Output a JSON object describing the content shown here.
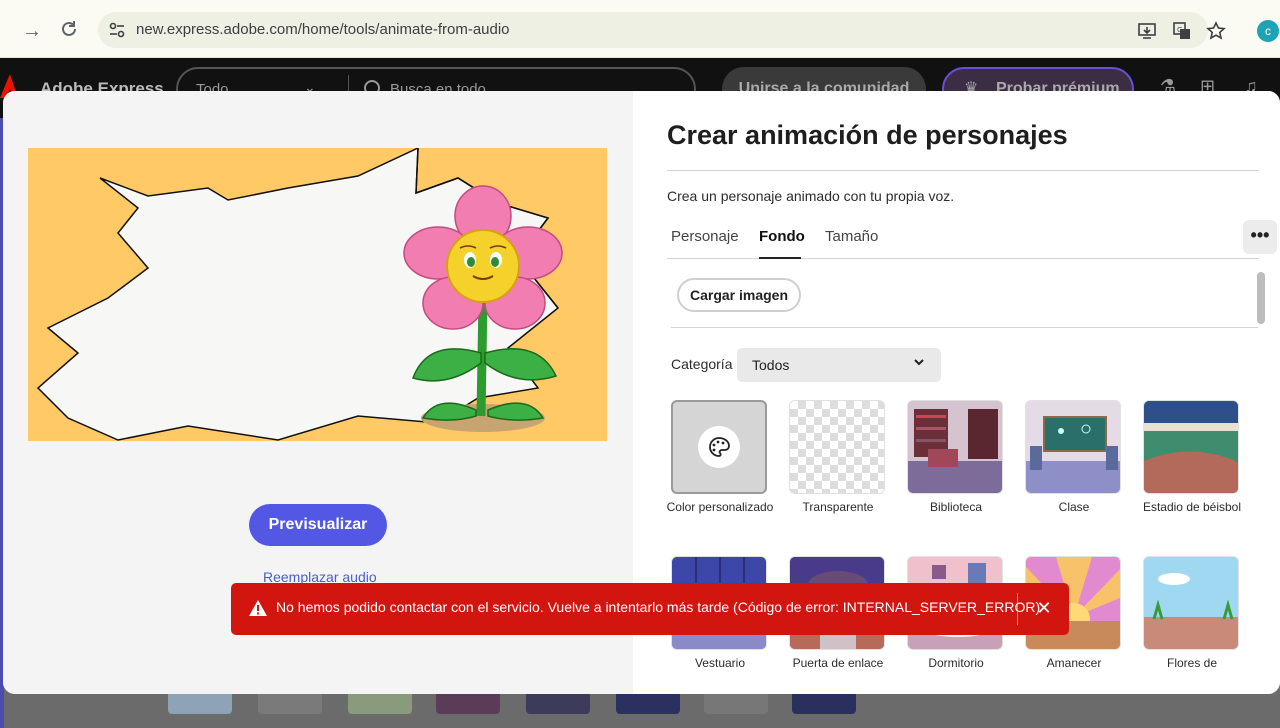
{
  "browser": {
    "url": "new.express.adobe.com/home/tools/animate-from-audio",
    "profile_initial": "c",
    "icons": [
      "back-arrow-icon",
      "reload-icon",
      "site-settings-icon",
      "install-icon",
      "translate-icon",
      "bookmark-star-icon"
    ]
  },
  "app_header": {
    "name": "Adobe Express",
    "filter_select": "Todo",
    "search_placeholder": "Busca en todo",
    "community_button": "Unirse a la comunidad",
    "premium_button": "Probar prémium",
    "icons": [
      "flask-icon",
      "apps-grid-icon",
      "bell-icon"
    ]
  },
  "modal": {
    "title": "Crear animación de personajes",
    "subtitle": "Crea un personaje animado con tu propia voz.",
    "tabs": [
      {
        "label": "Personaje",
        "active": false
      },
      {
        "label": "Fondo",
        "active": true
      },
      {
        "label": "Tamaño",
        "active": false
      }
    ],
    "more_icon": "•••",
    "upload_button": "Cargar imagen",
    "category_label": "Categoría",
    "category_value": "Todos",
    "backgrounds": [
      {
        "label": "Color personalizado",
        "selected": true
      },
      {
        "label": "Transparente"
      },
      {
        "label": "Biblioteca"
      },
      {
        "label": "Clase"
      },
      {
        "label": "Estadio de béisbol"
      },
      {
        "label": "Vestuario"
      },
      {
        "label": "Puerta de enlace"
      },
      {
        "label": "Dormitorio"
      },
      {
        "label": "Amanecer"
      },
      {
        "label": "Flores de"
      }
    ],
    "preview_button": "Previsualizar",
    "replace_audio_link": "Reemplazar audio"
  },
  "toast": {
    "message": "No hemos podido contactar con el servicio. Vuelve a intentarlo más tarde (Código de error: INTERNAL_SERVER_ERROR)",
    "close_icon": "✕",
    "color": "#d31510"
  },
  "colors": {
    "accent": "#5258e4",
    "canvas_bg": "#ffc965"
  }
}
